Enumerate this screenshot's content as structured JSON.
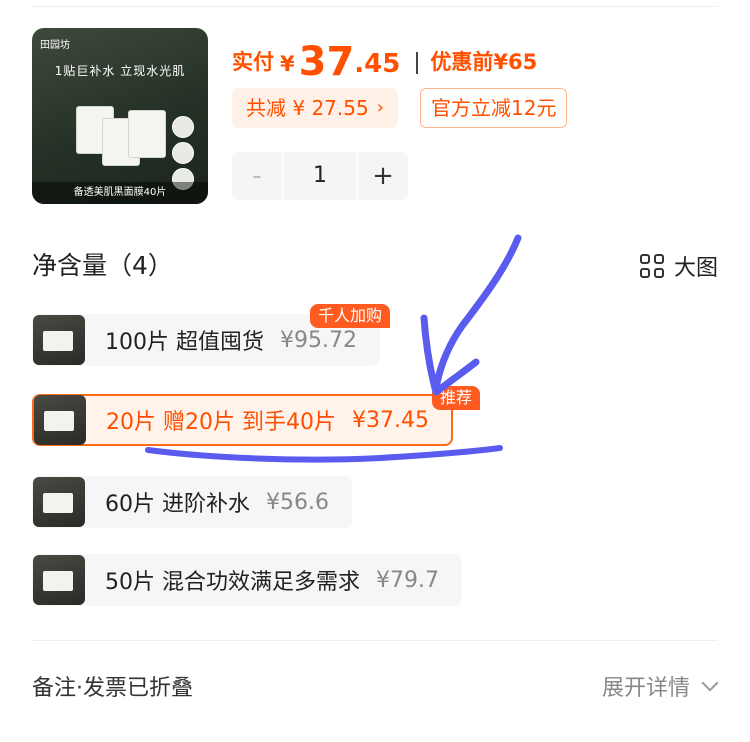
{
  "product": {
    "thumbnail": {
      "brand": "田园坊",
      "headline": "1贴巨补水 立现水光肌",
      "footer": "备透美肌黑面膜40片"
    }
  },
  "price": {
    "label": "实付",
    "currency": "¥",
    "integer": "37",
    "decimal": ".45",
    "original": "优惠前¥65",
    "save_chip": "共减 ¥ 27.55",
    "save_chip_arrow": "›",
    "official": "官方立减12元"
  },
  "stepper": {
    "minus": "-",
    "qty": "1",
    "plus": "+"
  },
  "section": {
    "title": "净含量（4）",
    "big_image_label": "大图",
    "big_image_icon": "grid-icon"
  },
  "options": [
    {
      "label": "100片 超值囤货",
      "price": "¥95.72",
      "badge": "千人加购",
      "selected": false
    },
    {
      "label": "20片 赠20片 到手40片",
      "price": "¥37.45",
      "badge": "推荐",
      "selected": true
    },
    {
      "label": "60片 进阶补水",
      "price": "¥56.6",
      "badge": "",
      "selected": false
    },
    {
      "label": "50片 混合功效满足多需求",
      "price": "¥79.7",
      "badge": "",
      "selected": false
    }
  ],
  "footer": {
    "note": "备注·发票已折叠",
    "expand": "展开详情",
    "expand_icon": "chevron-down-icon"
  },
  "colors": {
    "accent": "#ff5000",
    "annotation": "#5a5cf0"
  }
}
